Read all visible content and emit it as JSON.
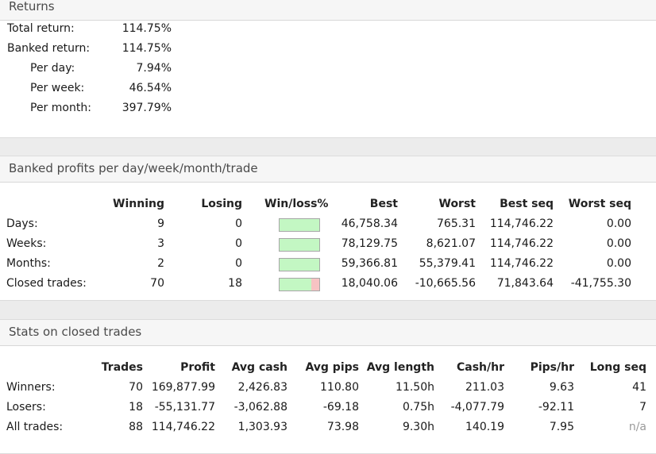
{
  "returns": {
    "title": "Returns",
    "rows": [
      {
        "label": "Total return:",
        "value": "114.75%"
      },
      {
        "label": "Banked return:",
        "value": "114.75%"
      },
      {
        "label": "Per day:",
        "value": "7.94%"
      },
      {
        "label": "Per week:",
        "value": "46.54%"
      },
      {
        "label": "Per month:",
        "value": "397.79%"
      }
    ]
  },
  "banked": {
    "title": "Banked profits per day/week/month/trade",
    "headers": [
      "Winning",
      "Losing",
      "Win/loss%",
      "Best",
      "Worst",
      "Best seq",
      "Worst seq"
    ],
    "rows": [
      {
        "label": "Days:",
        "winning": "9",
        "losing": "0",
        "win_fraction": 1.0,
        "best": "46,758.34",
        "worst": "765.31",
        "best_seq": "114,746.22",
        "worst_seq": "0.00"
      },
      {
        "label": "Weeks:",
        "winning": "3",
        "losing": "0",
        "win_fraction": 1.0,
        "best": "78,129.75",
        "worst": "8,621.07",
        "best_seq": "114,746.22",
        "worst_seq": "0.00"
      },
      {
        "label": "Months:",
        "winning": "2",
        "losing": "0",
        "win_fraction": 1.0,
        "best": "59,366.81",
        "worst": "55,379.41",
        "best_seq": "114,746.22",
        "worst_seq": "0.00"
      },
      {
        "label": "Closed trades:",
        "winning": "70",
        "losing": "18",
        "win_fraction": 0.795,
        "best": "18,040.06",
        "worst": "-10,665.56",
        "best_seq": "71,843.64",
        "worst_seq": "-41,755.30"
      }
    ]
  },
  "stats": {
    "title": "Stats on closed trades",
    "headers": [
      "Trades",
      "Profit",
      "Avg cash",
      "Avg pips",
      "Avg length",
      "Cash/hr",
      "Pips/hr",
      "Long seq"
    ],
    "rows": [
      {
        "label": "Winners:",
        "trades": "70",
        "profit": "169,877.99",
        "avg_cash": "2,426.83",
        "avg_pips": "110.80",
        "avg_length": "11.50h",
        "cash_hr": "211.03",
        "pips_hr": "9.63",
        "long_seq": "41"
      },
      {
        "label": "Losers:",
        "trades": "18",
        "profit": "-55,131.77",
        "avg_cash": "-3,062.88",
        "avg_pips": "-69.18",
        "avg_length": "0.75h",
        "cash_hr": "-4,077.79",
        "pips_hr": "-92.11",
        "long_seq": "7"
      },
      {
        "label": "All trades:",
        "trades": "88",
        "profit": "114,746.22",
        "avg_cash": "1,303.93",
        "avg_pips": "73.98",
        "avg_length": "9.30h",
        "cash_hr": "140.19",
        "pips_hr": "7.95",
        "long_seq": "n/a"
      }
    ]
  },
  "colors": {
    "win_bar": "#c3f7c3",
    "loss_bar": "#f7c3c3",
    "header_bg": "#f6f6f6"
  }
}
